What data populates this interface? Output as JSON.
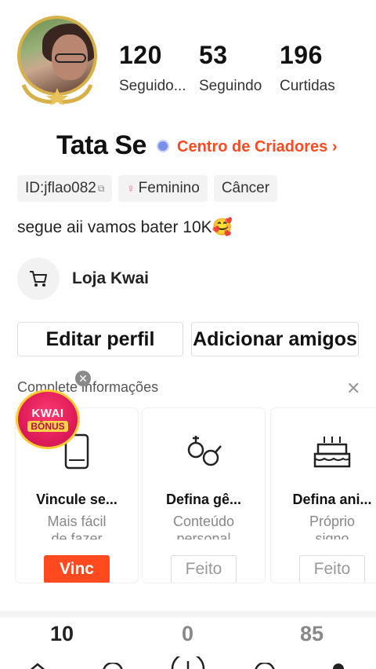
{
  "profile": {
    "name": "Tata Se",
    "creator_center": "Centro de Criadores ›",
    "id_tag": "ID:jflao082",
    "gender_tag": "Feminino",
    "sign_tag": "Câncer",
    "bio": "segue aii vamos bater 10K🥰",
    "shop_label": "Loja Kwai"
  },
  "stats": [
    {
      "value": "120",
      "label": "Seguido..."
    },
    {
      "value": "53",
      "label": "Seguindo"
    },
    {
      "value": "196",
      "label": "Curtidas"
    }
  ],
  "actions": {
    "edit_profile": "Editar perfil",
    "add_friends": "Adicionar amigos"
  },
  "complete_info": {
    "title": "Complete informações",
    "cards": [
      {
        "title": "Vincule se...",
        "sub1": "Mais fácil",
        "sub2": "de fazer",
        "button": "Vinc",
        "icon": "phone-icon"
      },
      {
        "title": "Defina gê...",
        "sub1": "Conteúdo",
        "sub2": "personal",
        "button": "Feito",
        "icon": "gender-icon"
      },
      {
        "title": "Defina ani...",
        "sub1": "Próprio",
        "sub2": "signo",
        "button": "Feito",
        "icon": "cake-icon"
      }
    ]
  },
  "bonus": {
    "line1": "KWAI",
    "line2": "BÔNUS"
  },
  "tab_counts": [
    "10",
    "0",
    "85"
  ],
  "colors": {
    "accent": "#ff4a1f",
    "bonus": "#e01c5a"
  }
}
